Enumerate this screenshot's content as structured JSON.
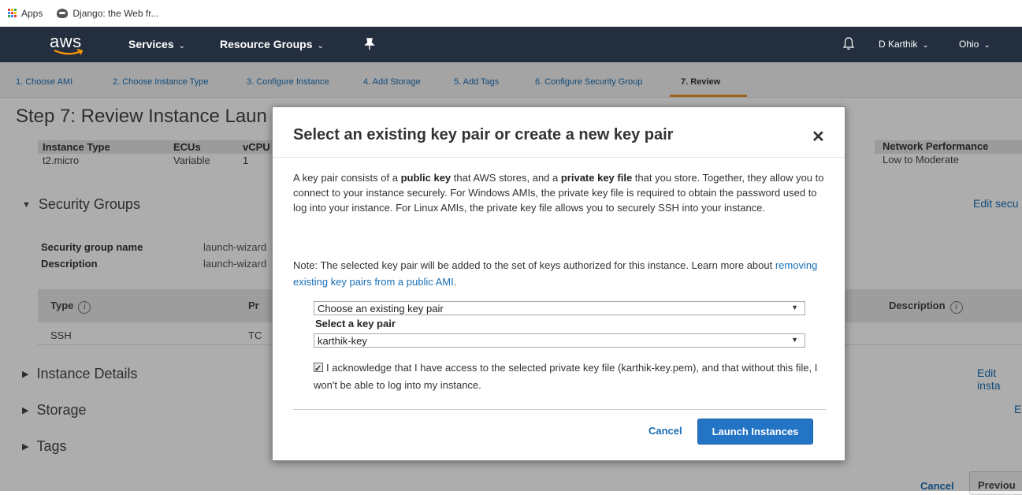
{
  "bookmarks": {
    "apps_label": "Apps",
    "django_label": "Django: the Web fr..."
  },
  "topnav": {
    "logo_text": "aws",
    "services": "Services",
    "resource_groups": "Resource Groups",
    "user": "D Karthik",
    "region": "Ohio"
  },
  "wizard_steps": [
    "1. Choose AMI",
    "2. Choose Instance Type",
    "3. Configure Instance",
    "4. Add Storage",
    "5. Add Tags",
    "6. Configure Security Group",
    "7. Review"
  ],
  "page": {
    "title": "Step 7: Review Instance Laun",
    "instance_table": {
      "headers": [
        "Instance Type",
        "ECUs",
        "vCPU"
      ],
      "row": [
        "t2.micro",
        "Variable",
        "1"
      ]
    },
    "network": {
      "header": "Network Performance",
      "value": "Low to Moderate"
    },
    "security_groups": {
      "title": "Security Groups",
      "edit": "Edit secu",
      "name_label": "Security group name",
      "name_value": "launch-wizard",
      "desc_label": "Description",
      "desc_value": "launch-wizard",
      "rules_headers": [
        "Type",
        "Pr",
        "Description"
      ],
      "rules_row": [
        "SSH",
        "TC"
      ]
    },
    "instance_details": {
      "title": "Instance Details",
      "edit": "Edit insta"
    },
    "storage": {
      "title": "Storage",
      "edit": "E"
    },
    "tags": {
      "title": "Tags"
    },
    "footer": {
      "cancel": "Cancel",
      "previous": "Previou"
    }
  },
  "modal": {
    "title": "Select an existing key pair or create a new key pair",
    "close": "✕",
    "intro_1": "A key pair consists of a ",
    "intro_b1": "public key",
    "intro_2": " that AWS stores, and a ",
    "intro_b2": "private key file",
    "intro_3": " that you store. Together, they allow you to connect to your instance securely. For Windows AMIs, the private key file is required to obtain the password used to log into your instance. For Linux AMIs, the private key file allows you to securely SSH into your instance.",
    "note_text": "Note: The selected key pair will be added to the set of keys authorized for this instance. Learn more about ",
    "note_link": "removing existing key pairs from a public AMI",
    "note_end": ".",
    "mode_select": "Choose an existing key pair",
    "key_label": "Select a key pair",
    "key_select": "karthik-key",
    "ack_text": "I acknowledge that I have access to the selected private key file (karthik-key.pem), and that without this file, I won't be able to log into my instance.",
    "ack_checked": true,
    "cancel": "Cancel",
    "launch": "Launch Instances"
  }
}
